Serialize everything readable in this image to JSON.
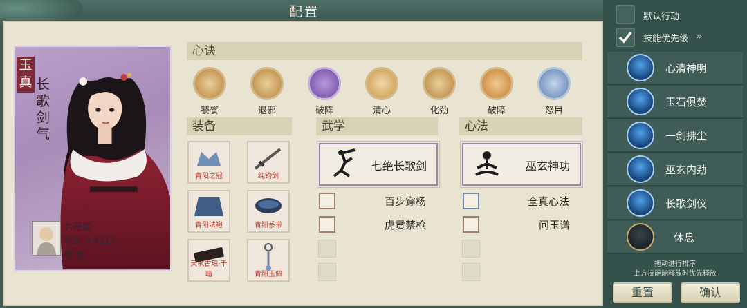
{
  "title": "配置",
  "character": {
    "tag": "玉真",
    "title": "长歌剑气",
    "player_name": "为菈妮",
    "score_label": "论剑分",
    "score_value": "4217",
    "guild_label": "帮 会"
  },
  "xinjue": {
    "header": "心诀",
    "items": [
      {
        "label": "饕餮",
        "icon": "taotie-icon"
      },
      {
        "label": "退邪",
        "icon": "tuixie-icon"
      },
      {
        "label": "破阵",
        "icon": "pozhen-icon"
      },
      {
        "label": "清心",
        "icon": "qingxin-icon"
      },
      {
        "label": "化劲",
        "icon": "huajin-icon"
      },
      {
        "label": "破障",
        "icon": "pozhang-icon"
      },
      {
        "label": "怒目",
        "icon": "numu-icon"
      }
    ]
  },
  "equipment": {
    "header": "装备",
    "items": [
      {
        "label": "青阳之冠"
      },
      {
        "label": "纯钧剑"
      },
      {
        "label": "青阳法袍"
      },
      {
        "label": "青阳系带"
      },
      {
        "label": "天枫古琅·千暗"
      },
      {
        "label": "青阳玉佩"
      }
    ]
  },
  "martial": {
    "header": "武学",
    "main": "七绝长歌剑",
    "list": [
      "百步穿杨",
      "虎贲禁枪"
    ]
  },
  "mind": {
    "header": "心法",
    "main": "巫玄神功",
    "list": [
      "全真心法",
      "问玉谱"
    ]
  },
  "sidebar": {
    "default_action": "默认行动",
    "skill_priority": "技能优先级",
    "skill_priority_arrow": "»",
    "skills": [
      {
        "label": "心清神明"
      },
      {
        "label": "玉石俱焚"
      },
      {
        "label": "一剑拂尘"
      },
      {
        "label": "巫玄内劲"
      },
      {
        "label": "长歌剑仪"
      },
      {
        "label": "休息"
      }
    ],
    "hint_line1": "拖动进行排序",
    "hint_line2": "上方技能能释放时优先释放",
    "reset": "重置",
    "confirm": "确认"
  },
  "colors": {
    "panel_bg": "#e8e4d1",
    "sidebar_bg": "#34514c",
    "card_purple": "#a88cb8",
    "accent_red": "#c0392b"
  }
}
